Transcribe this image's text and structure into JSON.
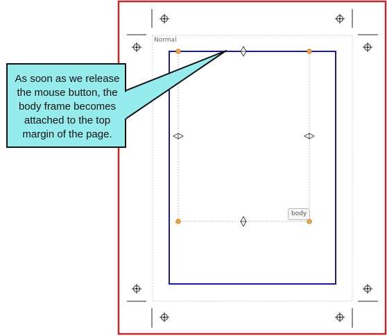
{
  "canvas": {
    "page_name": "Normal",
    "frame_tag": "body"
  },
  "callout": {
    "text": "As soon as we release the mouse button, the body frame becomes attached to the top margin of the page."
  },
  "colors": {
    "page_border": "#c0282c",
    "body_frame": "#1a1aa8",
    "handle": "#f2a53a",
    "callout_fill": "#96ecec",
    "guide": "#c8c8c8"
  },
  "icons": [
    "crosshair-icon",
    "resize-handle-icon",
    "resize-arrow-icon",
    "callout-pointer-icon"
  ]
}
